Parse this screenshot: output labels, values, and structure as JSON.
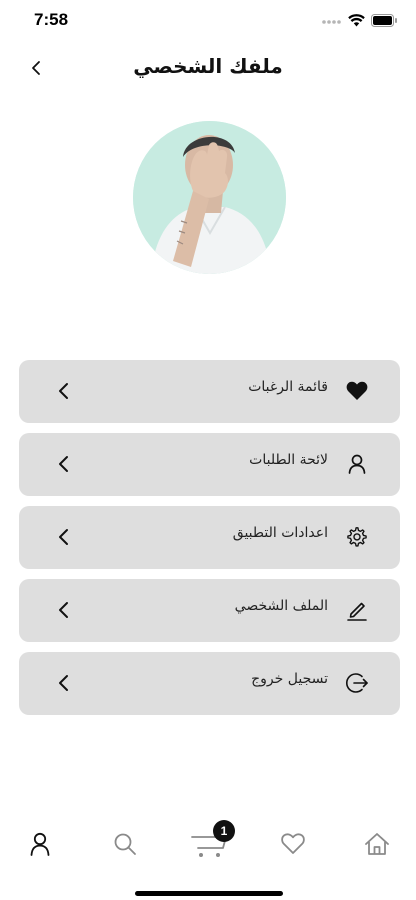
{
  "status_bar": {
    "time": "7:58"
  },
  "header": {
    "title": "ملفك الشخصي"
  },
  "menu": {
    "items": [
      {
        "label": "قائمة الرغبات",
        "icon": "heart-filled-icon"
      },
      {
        "label": "لائحة الطلبات",
        "icon": "user-icon"
      },
      {
        "label": "اعدادات التطبيق",
        "icon": "gear-icon"
      },
      {
        "label": "الملف الشخصي",
        "icon": "edit-pencil-icon"
      },
      {
        "label": "تسجيل خروج",
        "icon": "logout-icon"
      }
    ]
  },
  "bottom_nav": {
    "items": [
      "profile-icon",
      "search-icon",
      "cart-icon",
      "heart-icon",
      "home-icon"
    ],
    "cart_badge": "1"
  },
  "colors": {
    "background": "#ffffff",
    "menu_item_bg": "#dedede",
    "text": "#111111",
    "inactive_icon": "#8a8a8a"
  }
}
